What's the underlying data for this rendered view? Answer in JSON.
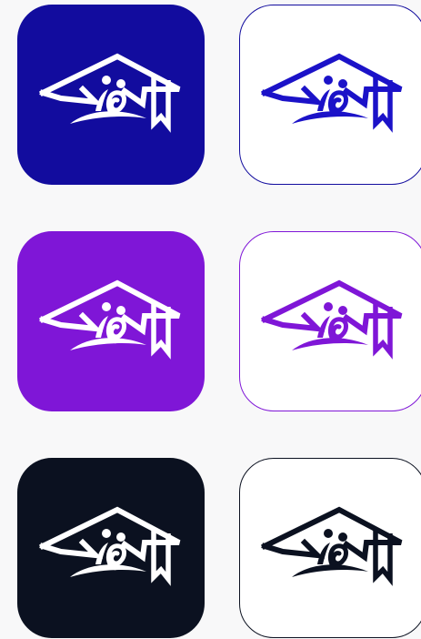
{
  "colors": {
    "background": "#f8f8f9",
    "navy": "#120c9e",
    "purple": "#7f16d7",
    "dark": "#0b1120",
    "white": "#ffffff"
  },
  "tiles": [
    {
      "variant": "filled",
      "color": "#120c9e",
      "logo_color": "#ffffff",
      "icon": "graduation-cap-logo"
    },
    {
      "variant": "outline",
      "color": "#120c9e",
      "logo_color": "#1b12c8",
      "icon": "graduation-cap-logo"
    },
    {
      "variant": "filled",
      "color": "#7f16d7",
      "logo_color": "#ffffff",
      "icon": "graduation-cap-logo"
    },
    {
      "variant": "outline",
      "color": "#7f16d7",
      "logo_color": "#7f16d7",
      "icon": "graduation-cap-logo"
    },
    {
      "variant": "filled",
      "color": "#0b1120",
      "logo_color": "#ffffff",
      "icon": "graduation-cap-logo"
    },
    {
      "variant": "outline",
      "color": "#0b1120",
      "logo_color": "#0b1120",
      "icon": "graduation-cap-logo"
    }
  ]
}
